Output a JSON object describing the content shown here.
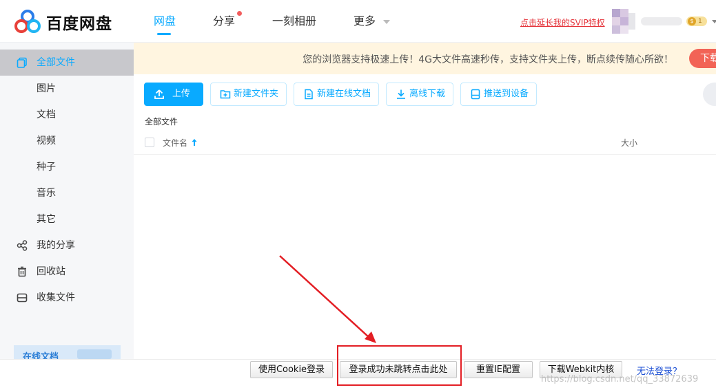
{
  "header": {
    "logo_text": "百度网盘",
    "nav": [
      {
        "label": "网盘",
        "active": true
      },
      {
        "label": "分享",
        "has_dot": true
      },
      {
        "label": "一刻相册"
      },
      {
        "label": "更多",
        "has_caret": true
      }
    ],
    "svip_link": "点击延长我的SVIP特权",
    "vip_coin": "$",
    "vip_level": "1"
  },
  "sidebar": {
    "items": [
      {
        "label": "全部文件",
        "icon": "files-icon",
        "active": true
      },
      {
        "label": "图片"
      },
      {
        "label": "文档"
      },
      {
        "label": "视频"
      },
      {
        "label": "种子"
      },
      {
        "label": "音乐"
      },
      {
        "label": "其它"
      },
      {
        "label": "我的分享",
        "icon": "share-icon"
      },
      {
        "label": "回收站",
        "icon": "trash-icon"
      },
      {
        "label": "收集文件",
        "icon": "collect-icon"
      }
    ],
    "promo_text": "在线文档"
  },
  "banner": {
    "message": "您的浏览器支持极速上传！4G大文件高速秒传，支持文件夹上传，断点续传随心所欲！",
    "download_label": "下载"
  },
  "toolbar": {
    "upload": "上传",
    "new_folder": "新建文件夹",
    "new_doc": "新建在线文档",
    "offline": "离线下载",
    "push": "推送到设备"
  },
  "breadcrumb": "全部文件",
  "list": {
    "col_name": "文件名",
    "col_size": "大小"
  },
  "bottom": {
    "cookie_login": "使用Cookie登录",
    "login_success": "登录成功未跳转点击此处",
    "reset_ie": "重置IE配置",
    "download_webkit": "下载Webkit内核",
    "cannot_login": "无法登录？"
  },
  "watermark": "https://blog.csdn.net/qq_33872639",
  "colors": {
    "accent": "#09aaff",
    "annotation_red": "#e31e24"
  }
}
